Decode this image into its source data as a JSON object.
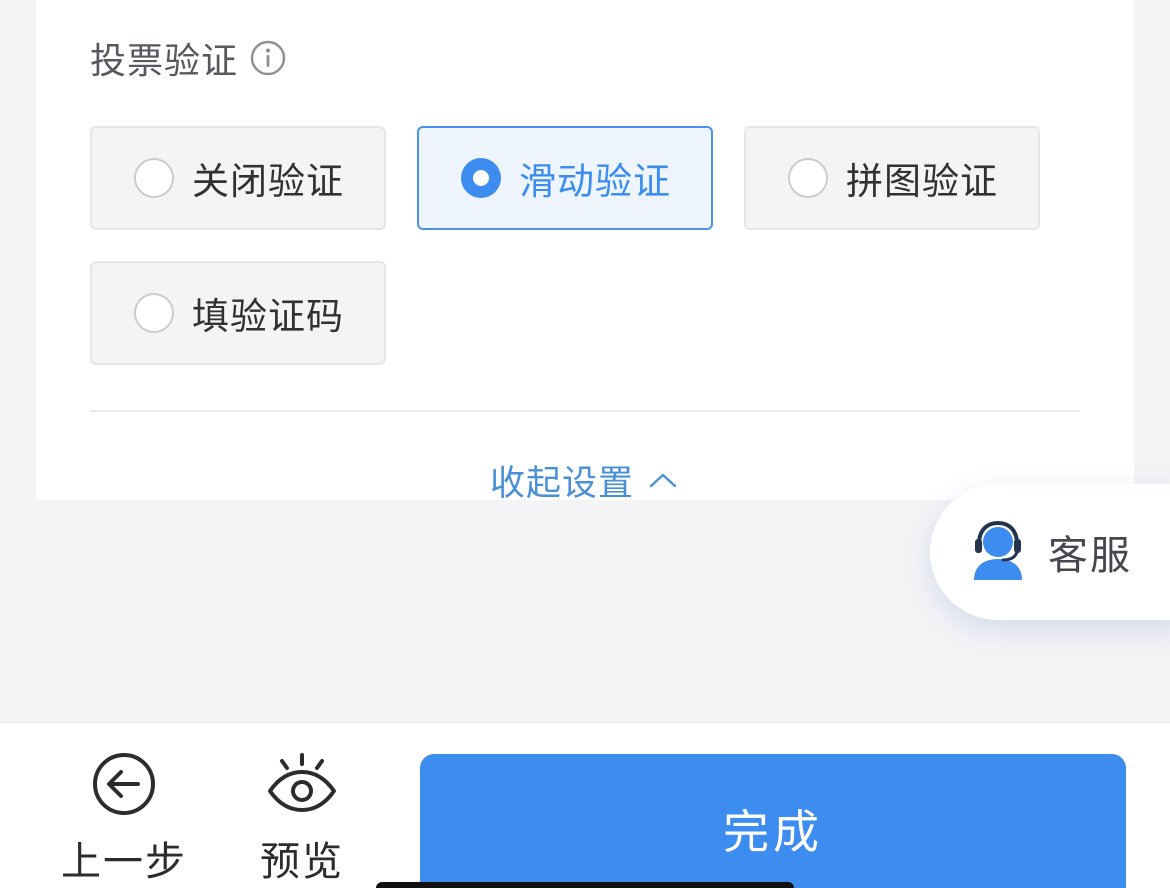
{
  "verification": {
    "title": "投票验证",
    "info_icon": "info-circle-icon",
    "options": [
      {
        "label": "关闭验证",
        "selected": false
      },
      {
        "label": "滑动验证",
        "selected": true
      },
      {
        "label": "拼图验证",
        "selected": false
      },
      {
        "label": "填验证码",
        "selected": false
      }
    ],
    "collapse_label": "收起设置",
    "collapse_icon": "chevron-up-icon"
  },
  "service": {
    "label": "客服",
    "icon": "headset-agent-icon"
  },
  "bottom_bar": {
    "back_label": "上一步",
    "back_icon": "arrow-left-circle-icon",
    "preview_label": "预览",
    "preview_icon": "eye-icon",
    "done_label": "完成"
  },
  "colors": {
    "accent": "#3d8cf0",
    "link": "#4a90d8",
    "selected_bg": "#eef5ff",
    "option_bg": "#f4f4f5",
    "page_bg": "#f4f4f6"
  }
}
